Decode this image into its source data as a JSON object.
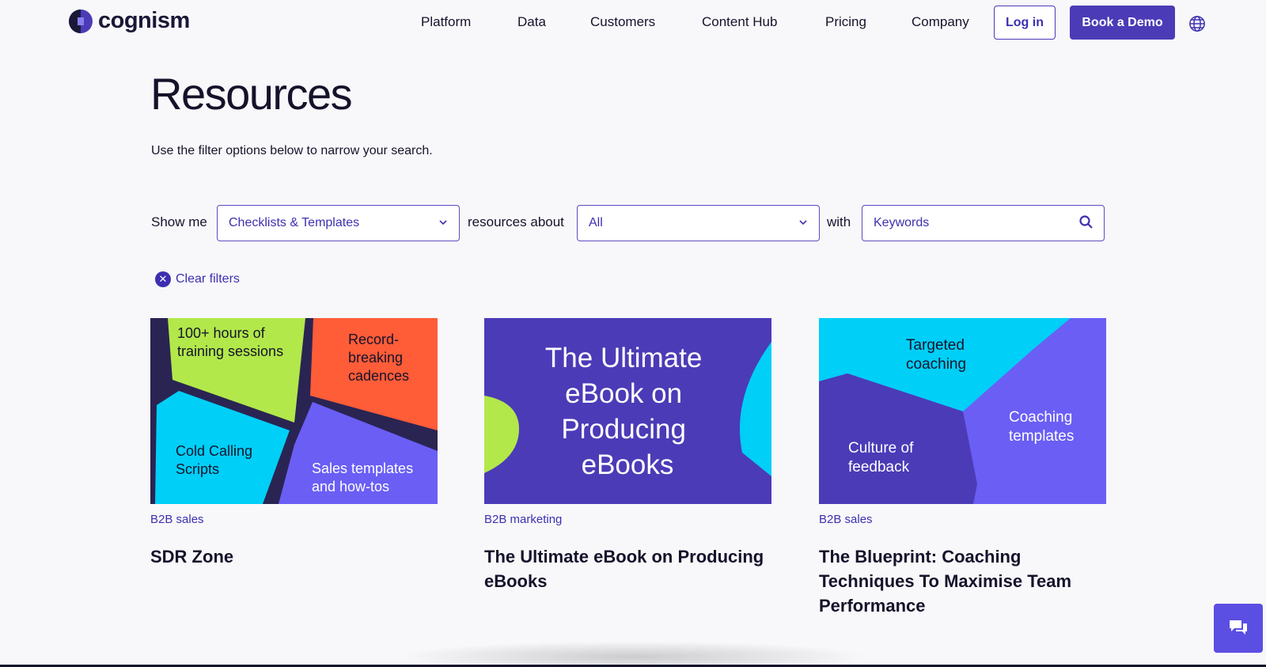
{
  "brand": {
    "name": "cognism",
    "accent": "#4b3bb7",
    "link_color": "#3d30b0"
  },
  "nav": {
    "items": [
      "Platform",
      "Data",
      "Customers",
      "Content Hub",
      "Pricing",
      "Company"
    ],
    "login_label": "Log in",
    "demo_label": "Book a Demo",
    "globe_icon": "globe-icon"
  },
  "hero": {
    "title": "Resources",
    "subtitle": "Use the filter options below to narrow your search."
  },
  "filters": {
    "show_me_label": "Show me",
    "type_value": "Checklists & Templates",
    "about_label": "resources about",
    "topic_value": "All",
    "with_label": "with",
    "keyword_placeholder": "Keywords",
    "clear_label": "Clear filters"
  },
  "cards": [
    {
      "tag": "B2B sales",
      "title": "SDR Zone",
      "image_text": [
        "100+ hours of training sessions",
        "Record-breaking cadences",
        "Cold Calling Scripts",
        "Sales templates and how-tos"
      ]
    },
    {
      "tag": "B2B marketing",
      "title": "The Ultimate eBook on Producing eBooks",
      "image_text": [
        "The Ultimate eBook on Producing eBooks"
      ]
    },
    {
      "tag": "B2B sales",
      "title": "The Blueprint: Coaching Techniques To Maximise Team Performance",
      "image_text": [
        "Targeted coaching",
        "Coaching templates",
        "Culture of feedback"
      ]
    }
  ]
}
